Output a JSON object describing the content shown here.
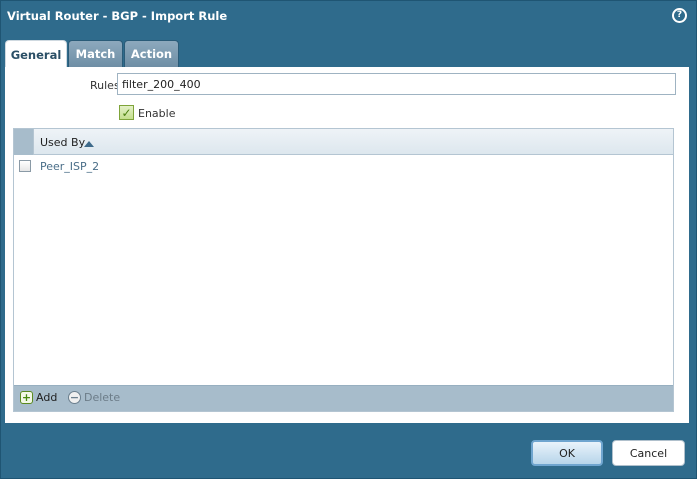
{
  "dialog": {
    "title": "Virtual Router - BGP - Import Rule",
    "help_icon": "?"
  },
  "tabs": [
    {
      "label": "General",
      "active": true
    },
    {
      "label": "Match",
      "active": false
    },
    {
      "label": "Action",
      "active": false
    }
  ],
  "form": {
    "rules_label": "Rules",
    "rules_value": "filter_200_400",
    "enable_label": "Enable",
    "enable_checked": true
  },
  "grid": {
    "column_header": "Used By",
    "sort": "ascending",
    "rows": [
      {
        "value": "Peer_ISP_2",
        "checked": false
      }
    ],
    "add_label": "Add",
    "delete_label": "Delete"
  },
  "buttons": {
    "ok_label": "OK",
    "cancel_label": "Cancel"
  },
  "colors": {
    "frame": "#2f6b8c",
    "accent": "#6fa5cf"
  }
}
